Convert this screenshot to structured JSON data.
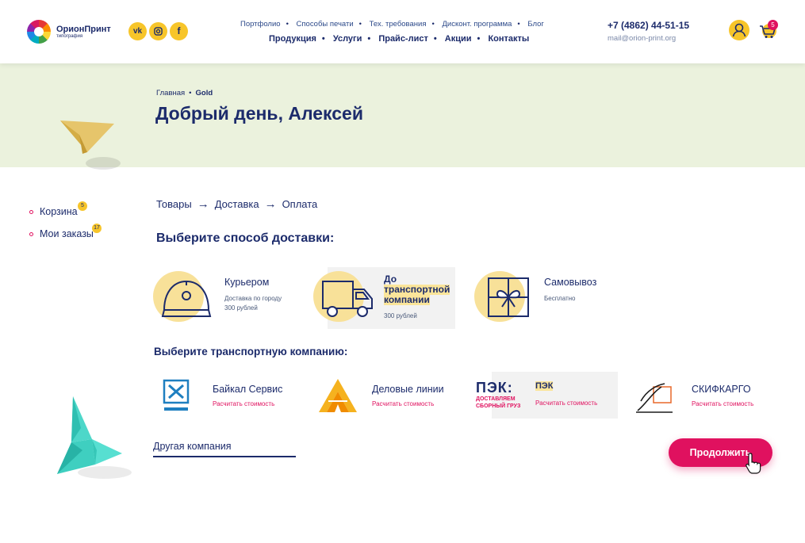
{
  "header": {
    "brand_name": "ОрионПринт",
    "brand_sub": "типография",
    "social": [
      "vk",
      "in",
      "f"
    ],
    "nav_top": [
      "Портфолио",
      "Способы печати",
      "Тех. требования",
      "Дисконт. программа",
      "Блог"
    ],
    "nav_bottom": [
      "Продукция",
      "Услуги",
      "Прайс-лист",
      "Акции",
      "Контакты"
    ],
    "phone": "+7 (4862) 44-51-15",
    "email": "mail@orion-print.org",
    "cart_count": "5"
  },
  "breadcrumb": {
    "home": "Главная",
    "current": "Gold"
  },
  "page_title": "Добрый день, Алексей",
  "sidebar": {
    "items": [
      {
        "label": "Корзина",
        "badge": "5"
      },
      {
        "label": "Мои заказы",
        "badge": "17"
      }
    ]
  },
  "steps": [
    "Товары",
    "Доставка",
    "Оплата"
  ],
  "delivery": {
    "title": "Выберите способ доставки:",
    "options": [
      {
        "title": "Курьером",
        "desc1": "Доставка по городу",
        "desc2": "300 рублей"
      },
      {
        "title_line1": "До",
        "title_line2": "транспортной",
        "title_line3": "компании",
        "desc1": "300 рублей"
      },
      {
        "title": "Самовывоз",
        "desc1": "Бесплатно"
      }
    ]
  },
  "carriers": {
    "title": "Выберите транспортную компанию:",
    "items": [
      {
        "name": "Байкал Сервис",
        "link": "Расчитать стоимость"
      },
      {
        "name": "Деловые линии",
        "link": "Расчитать стоимость"
      },
      {
        "name": "ПЭК",
        "logo_text": "ПЭК:",
        "logo_sub1": "ДОСТАВЛЯЕМ",
        "logo_sub2": "СБОРНЫЙ ГРУЗ",
        "link": "Расчитать стоимость"
      },
      {
        "name": "СКИФКАРГО",
        "link": "Расчитать стоимость"
      }
    ],
    "other_placeholder": "Другая компания"
  },
  "continue_label": "Продолжить",
  "colors": {
    "navy": "#1c2b6b",
    "yellow": "#f7c52a",
    "magenta": "#e0115f",
    "banner": "#ebf2dd"
  }
}
